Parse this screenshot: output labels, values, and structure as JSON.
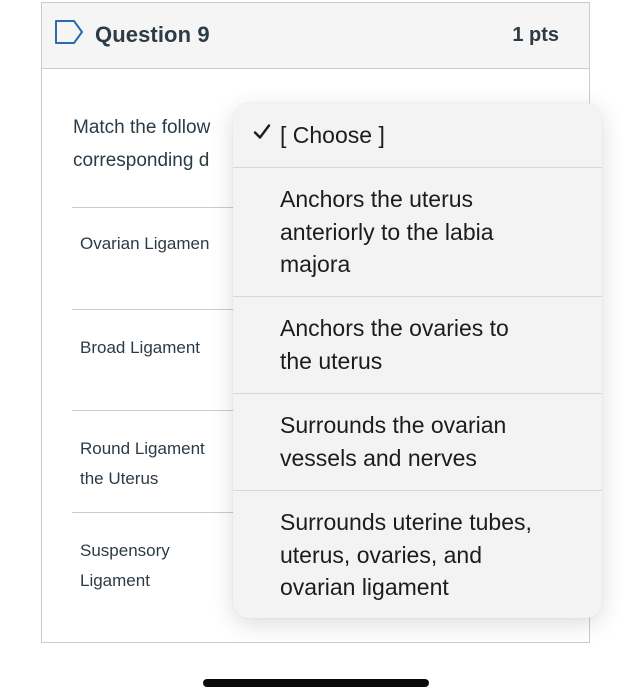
{
  "question": {
    "title": "Question 9",
    "points": "1 pts",
    "text_lines": [
      "Match the follow",
      "corresponding d"
    ]
  },
  "match_rows": [
    {
      "label_lines": [
        "Ovarian Ligamen"
      ]
    },
    {
      "label_lines": [
        "Broad Ligament"
      ]
    },
    {
      "label_lines": [
        "Round Ligament",
        "the Uterus"
      ]
    },
    {
      "label_lines": [
        "Suspensory",
        "Ligament"
      ]
    }
  ],
  "dropdown": {
    "selected_index": 0,
    "options": [
      {
        "lines": [
          "[ Choose ]"
        ]
      },
      {
        "lines": [
          "Anchors the uterus",
          "anteriorly to the labia",
          "majora"
        ]
      },
      {
        "lines": [
          "Anchors the ovaries to",
          "the uterus"
        ]
      },
      {
        "lines": [
          "Surrounds the ovarian",
          "vessels and nerves"
        ]
      },
      {
        "lines": [
          "Surrounds uterine tubes,",
          "uterus, ovaries, and",
          "ovarian ligament"
        ]
      }
    ]
  },
  "icons": {
    "flag": "flag-icon",
    "check": "checkmark-icon"
  },
  "colors": {
    "header_bg": "#f5f5f5",
    "border": "#c7cdd1",
    "text": "#2d3b45",
    "menu_bg": "#f3f3f3"
  }
}
